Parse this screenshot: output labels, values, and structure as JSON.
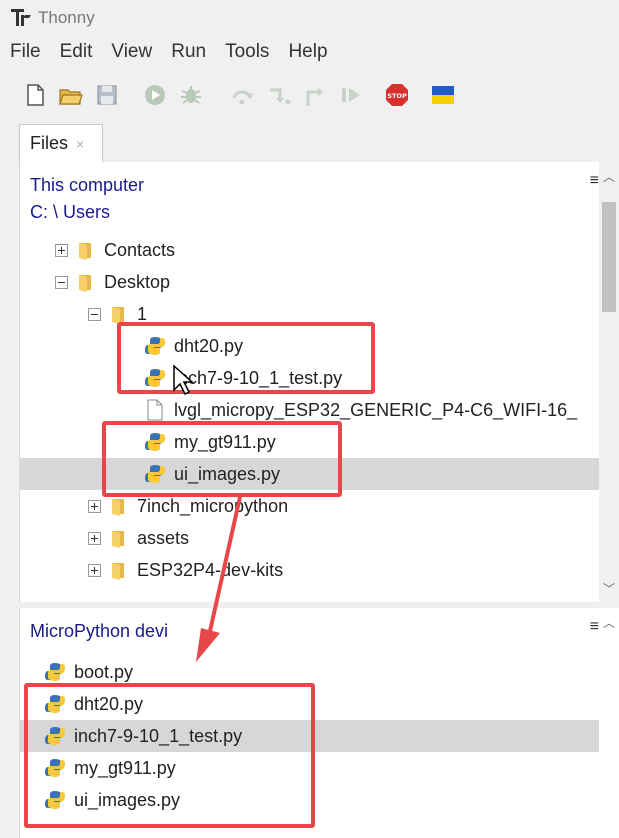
{
  "app": {
    "title": "Thonny"
  },
  "menu": {
    "items": [
      "File",
      "Edit",
      "View",
      "Run",
      "Tools",
      "Help"
    ]
  },
  "toolbar": {
    "buttons": [
      "new-file-icon",
      "open-file-icon",
      "save-icon",
      "run-icon",
      "debug-icon",
      "step-over-icon",
      "step-into-icon",
      "step-out-icon",
      "resume-icon",
      "stop-icon",
      "ukraine-flag-icon"
    ],
    "stop_label": "STOP"
  },
  "tabs": [
    {
      "label": "Files",
      "close": "×"
    }
  ],
  "this_computer": {
    "title": "This computer",
    "path": "C: \\ Users",
    "items": [
      {
        "label": "Contacts",
        "type": "folder",
        "expander": "plus"
      },
      {
        "label": "Desktop",
        "type": "folder",
        "expander": "minus"
      },
      {
        "label": "1",
        "type": "folder",
        "expander": "minus"
      },
      {
        "label": "dht20.py",
        "type": "python"
      },
      {
        "label": "inch7-9-10_1_test.py",
        "type": "python"
      },
      {
        "label": "lvgl_micropy_ESP32_GENERIC_P4-C6_WIFI-16_",
        "type": "file"
      },
      {
        "label": "my_gt911.py",
        "type": "python"
      },
      {
        "label": "ui_images.py",
        "type": "python",
        "selected": true
      },
      {
        "label": "7inch_micropython",
        "type": "folder",
        "expander": "plus"
      },
      {
        "label": "assets",
        "type": "folder",
        "expander": "plus"
      },
      {
        "label": "ESP32P4-dev-kits",
        "type": "folder",
        "expander": "plus"
      }
    ]
  },
  "device": {
    "title": "MicroPython devi",
    "items": [
      {
        "label": "boot.py"
      },
      {
        "label": "dht20.py"
      },
      {
        "label": "inch7-9-10_1_test.py",
        "selected": true
      },
      {
        "label": "my_gt911.py"
      },
      {
        "label": "ui_images.py"
      }
    ]
  },
  "colors": {
    "highlight": "#e8474a",
    "panel_title": "#1a1a8c",
    "selection": "#d7d7d7"
  }
}
